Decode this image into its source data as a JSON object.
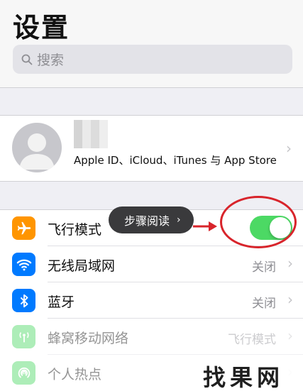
{
  "header": {
    "title": "设置"
  },
  "search": {
    "placeholder": "搜索"
  },
  "profile": {
    "subtitle": "Apple ID、iCloud、iTunes 与 App Store",
    "chevron": "›"
  },
  "tooltip": {
    "label": "步骤阅读",
    "chevron": "›"
  },
  "settings": {
    "items": [
      {
        "label": "飞行模式",
        "icon": "airplane-icon",
        "icon_color": "#ff9500",
        "toggle_on": true
      },
      {
        "label": "无线局域网",
        "icon": "wifi-icon",
        "icon_color": "#007aff",
        "value": "关闭",
        "chevron": "›"
      },
      {
        "label": "蓝牙",
        "icon": "bluetooth-icon",
        "icon_color": "#007aff",
        "value": "关闭",
        "chevron": "›"
      },
      {
        "label": "蜂窝移动网络",
        "icon": "cellular-icon",
        "icon_color": "#4cd964",
        "value": "飞行模式",
        "chevron": "›"
      },
      {
        "label": "个人热点",
        "icon": "hotspot-icon",
        "icon_color": "#4cd964",
        "value": "",
        "chevron": "›"
      }
    ]
  },
  "colors": {
    "toggle_on": "#4cd964",
    "annotation": "#d8242b",
    "background": "#efeff4"
  },
  "watermark": {
    "text": "找果网"
  }
}
